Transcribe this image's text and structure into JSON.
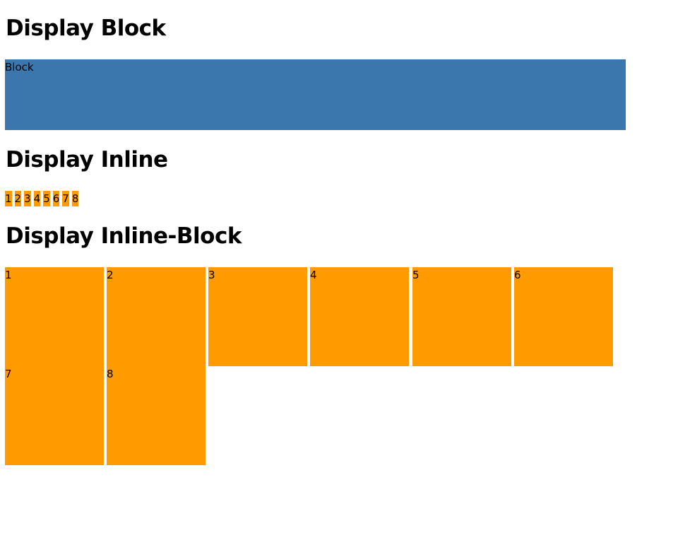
{
  "headings": {
    "block": "Display Block",
    "inline": "Display Inline",
    "inline_block": "Display Inline-Block"
  },
  "block_box": {
    "label": "Block",
    "color": "#3b77ad"
  },
  "inline_items": [
    "1",
    "2",
    "3",
    "4",
    "5",
    "6",
    "7",
    "8"
  ],
  "inline_block_items": [
    "1",
    "2",
    "3",
    "4",
    "5",
    "6",
    "7",
    "8"
  ],
  "item_color": "#ff9a00"
}
